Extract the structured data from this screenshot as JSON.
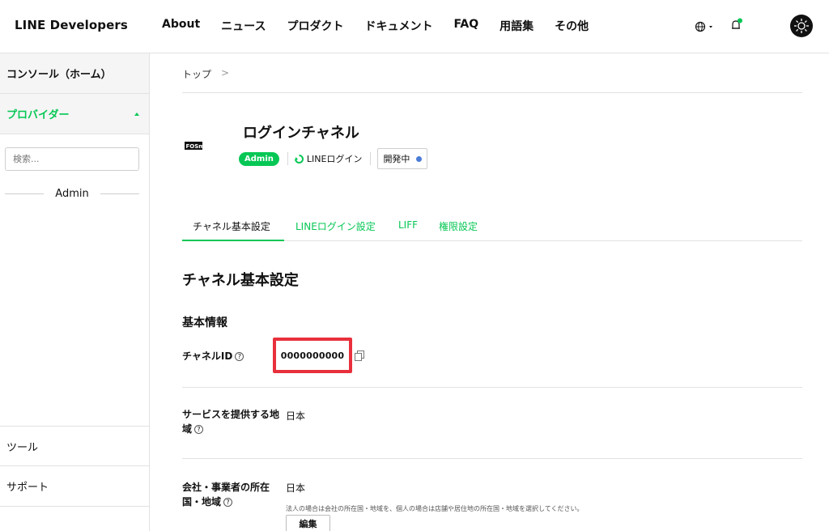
{
  "header": {
    "logo": "LINE Developers",
    "nav": [
      "About",
      "ニュース",
      "プロダクト",
      "ドキュメント",
      "FAQ",
      "用語集",
      "その他"
    ]
  },
  "sidebar": {
    "home": "コンソール（ホーム）",
    "provider": "プロバイダー",
    "search_placeholder": "検索...",
    "group": "Admin",
    "tools": "ツール",
    "support": "サポート"
  },
  "breadcrumb": {
    "top": "トップ",
    "sep": ">"
  },
  "channel": {
    "icon_text": "FOSma",
    "title": "ログインチャネル",
    "role_badge": "Admin",
    "type": "LINEログイン",
    "status": "開発中"
  },
  "tabs": [
    "チャネル基本設定",
    "LINEログイン設定",
    "LIFF",
    "権限設定"
  ],
  "section": {
    "title": "チャネル基本設定",
    "subtitle": "基本情報"
  },
  "fields": {
    "channel_id_label": "チャネルID",
    "channel_id_value": "0000000000",
    "region_label": "サービスを提供する地域",
    "region_value": "日本",
    "country_label": "会社・事業者の所在国・地域",
    "country_value": "日本",
    "country_note": "法人の場合は会社の所在国・地域を、個人の場合は店舗や居住地の所在国・地域を選択してください。",
    "edit_button": "編集"
  },
  "colors": {
    "accent": "#06c755",
    "highlight": "#e8303c",
    "status_dot": "#4a7bd6"
  }
}
